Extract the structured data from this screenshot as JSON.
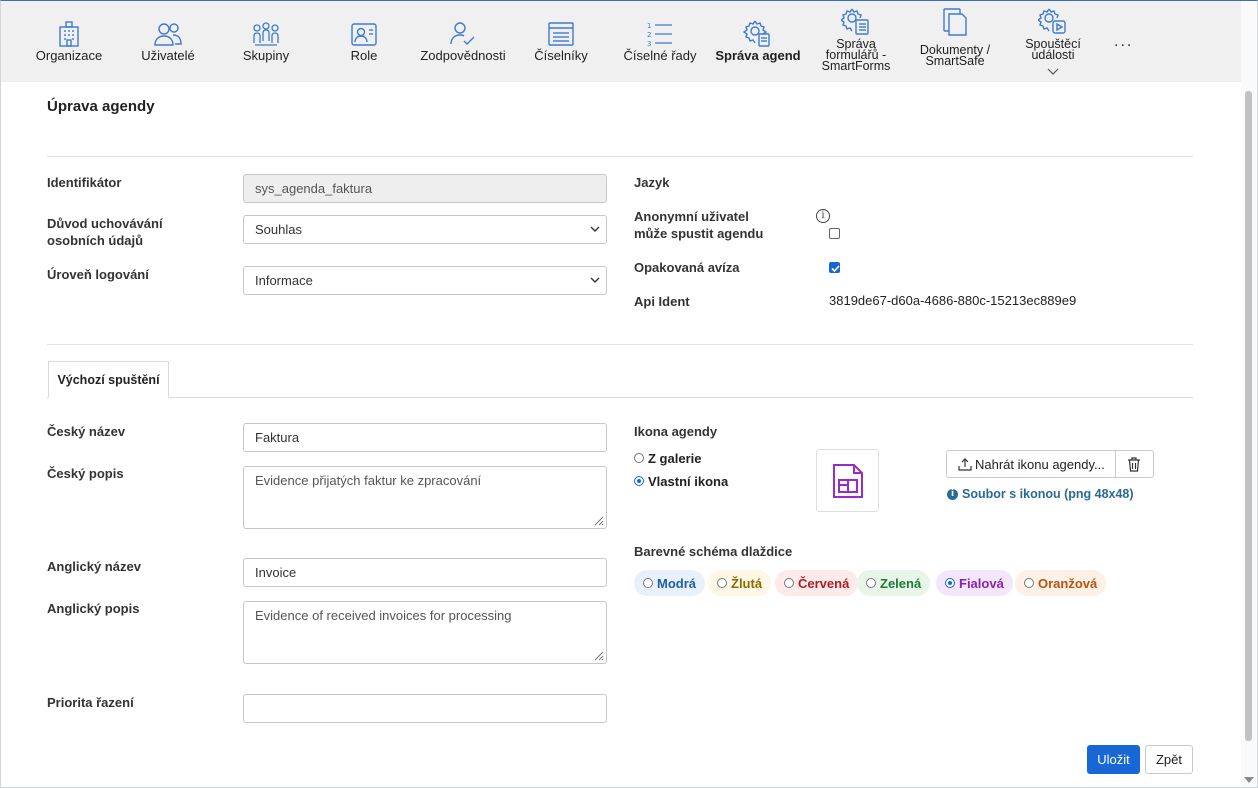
{
  "toolbar": {
    "items": [
      {
        "label": "Organizace",
        "icon": "building-icon"
      },
      {
        "label": "Uživatelé",
        "icon": "users-icon"
      },
      {
        "label": "Skupiny",
        "icon": "groups-icon"
      },
      {
        "label": "Role",
        "icon": "role-card-icon"
      },
      {
        "label": "Zodpovědnosti",
        "icon": "user-check-icon"
      },
      {
        "label": "Číselníky",
        "icon": "list-window-icon"
      },
      {
        "label": "Číselné řady",
        "icon": "numbered-list-icon"
      },
      {
        "label": "Správa agend",
        "icon": "gear-document-icon",
        "active": true
      },
      {
        "label": "Správa formulářů - SmartForms",
        "icon": "gear-form-icon"
      },
      {
        "label": "Dokumenty / SmartSafe",
        "icon": "documents-icon"
      },
      {
        "label": "Spouštěcí události",
        "icon": "gear-play-icon"
      }
    ],
    "more": "..."
  },
  "page": {
    "title": "Úprava agendy"
  },
  "general": {
    "identifier_label": "Identifikátor",
    "identifier_value": "sys_agenda_faktura",
    "retention_label": "Důvod uchovávání osobních údajů",
    "retention_value": "Souhlas",
    "logging_label": "Úroveň logování",
    "logging_value": "Informace",
    "language_label": "Jazyk",
    "anonymous_label": "Anonymní uživatel může spustit agendu",
    "anonymous_checked": false,
    "repeat_label": "Opakovaná avíza",
    "repeat_checked": true,
    "api_label": "Api Ident",
    "api_value": "3819de67-d60a-4686-880c-15213ec889e9"
  },
  "tabs": [
    "Výchozí spuštění"
  ],
  "launch": {
    "cz_name_label": "Český název",
    "cz_name_value": "Faktura",
    "cz_desc_label": "Český popis",
    "cz_desc_value": "Evidence přijatých faktur ke zpracování",
    "en_name_label": "Anglický název",
    "en_name_value": "Invoice",
    "en_desc_label": "Anglický popis",
    "en_desc_value": "Evidence of received invoices for processing",
    "priority_label": "Priorita řazení",
    "priority_value": ""
  },
  "icon": {
    "label": "Ikona agendy",
    "option_gallery": "Z galerie",
    "option_custom": "Vlastní ikona",
    "selected": "custom",
    "upload_label": "Nahrát ikonu agendy...",
    "hint": "Soubor s ikonou (png 48x48)",
    "preview_color": "#9b2bc4"
  },
  "scheme": {
    "label": "Barevné schéma dlaždice",
    "options": [
      {
        "label": "Modrá",
        "bg": "#e8f1fb",
        "fg": "#1f5fa8"
      },
      {
        "label": "Žlutá",
        "bg": "#fdf8e6",
        "fg": "#8a6a00"
      },
      {
        "label": "Červená",
        "bg": "#fdeaea",
        "fg": "#b01d1d"
      },
      {
        "label": "Zelená",
        "bg": "#e8f6ea",
        "fg": "#1f7a33"
      },
      {
        "label": "Fialová",
        "bg": "#f4e6fb",
        "fg": "#8a23b0"
      },
      {
        "label": "Oranžová",
        "bg": "#fdf0e6",
        "fg": "#b5540f"
      }
    ],
    "selected": "Fialová"
  },
  "actions": {
    "save": "Uložit",
    "back": "Zpět"
  }
}
